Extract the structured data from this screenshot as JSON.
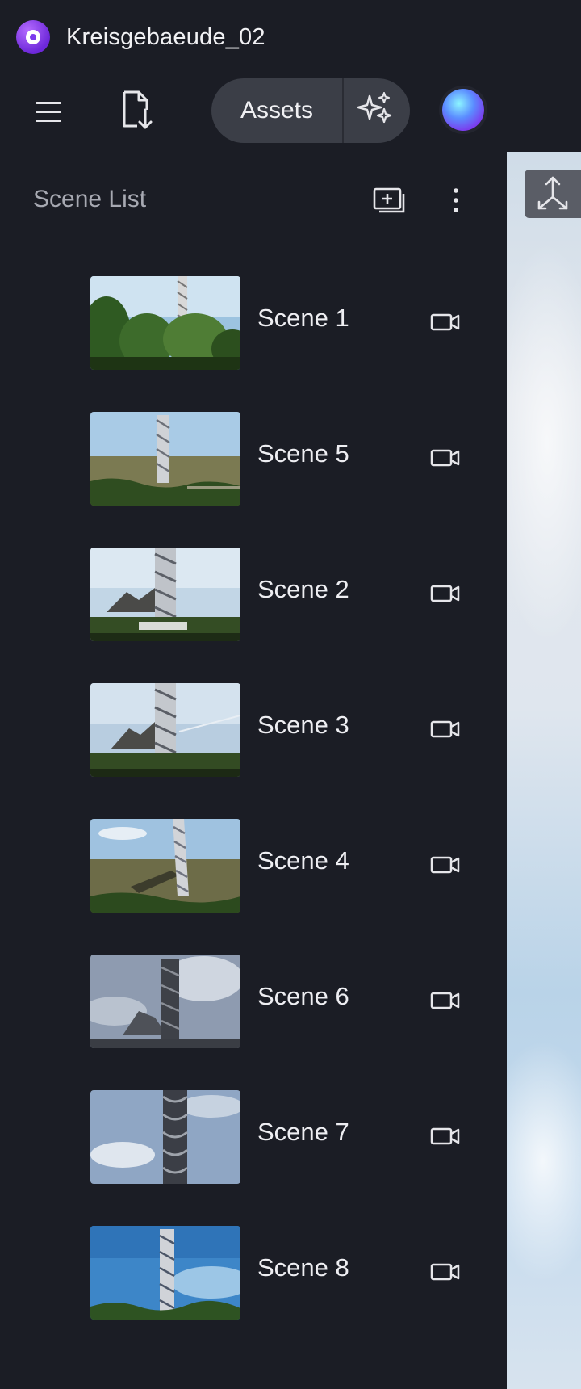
{
  "app": {
    "title": "Kreisgebaeude_02",
    "logo_icon": "app-logo-icon"
  },
  "toolbar": {
    "menu_icon": "hamburger-menu-icon",
    "export_icon": "file-export-icon",
    "assets_label": "Assets",
    "ai_icon": "sparkles-icon",
    "avatar": "user-avatar"
  },
  "scene_list": {
    "title": "Scene List",
    "add_icon": "add-scene-icon",
    "more_icon": "more-vertical-icon",
    "scenes": [
      {
        "label": "Scene 1",
        "icon": "camera-icon"
      },
      {
        "label": "Scene 5",
        "icon": "camera-icon"
      },
      {
        "label": "Scene 2",
        "icon": "camera-icon"
      },
      {
        "label": "Scene 3",
        "icon": "camera-icon"
      },
      {
        "label": "Scene 4",
        "icon": "camera-icon"
      },
      {
        "label": "Scene 6",
        "icon": "camera-icon"
      },
      {
        "label": "Scene 7",
        "icon": "camera-icon"
      },
      {
        "label": "Scene 8",
        "icon": "camera-icon"
      }
    ]
  },
  "viewport": {
    "button_icon": "share-arrows-icon"
  },
  "colors": {
    "background": "#1b1d25",
    "pill": "#3b3e47",
    "accent": "#7c3aed",
    "text": "#eeeef2",
    "muted": "#a7a9b2"
  }
}
